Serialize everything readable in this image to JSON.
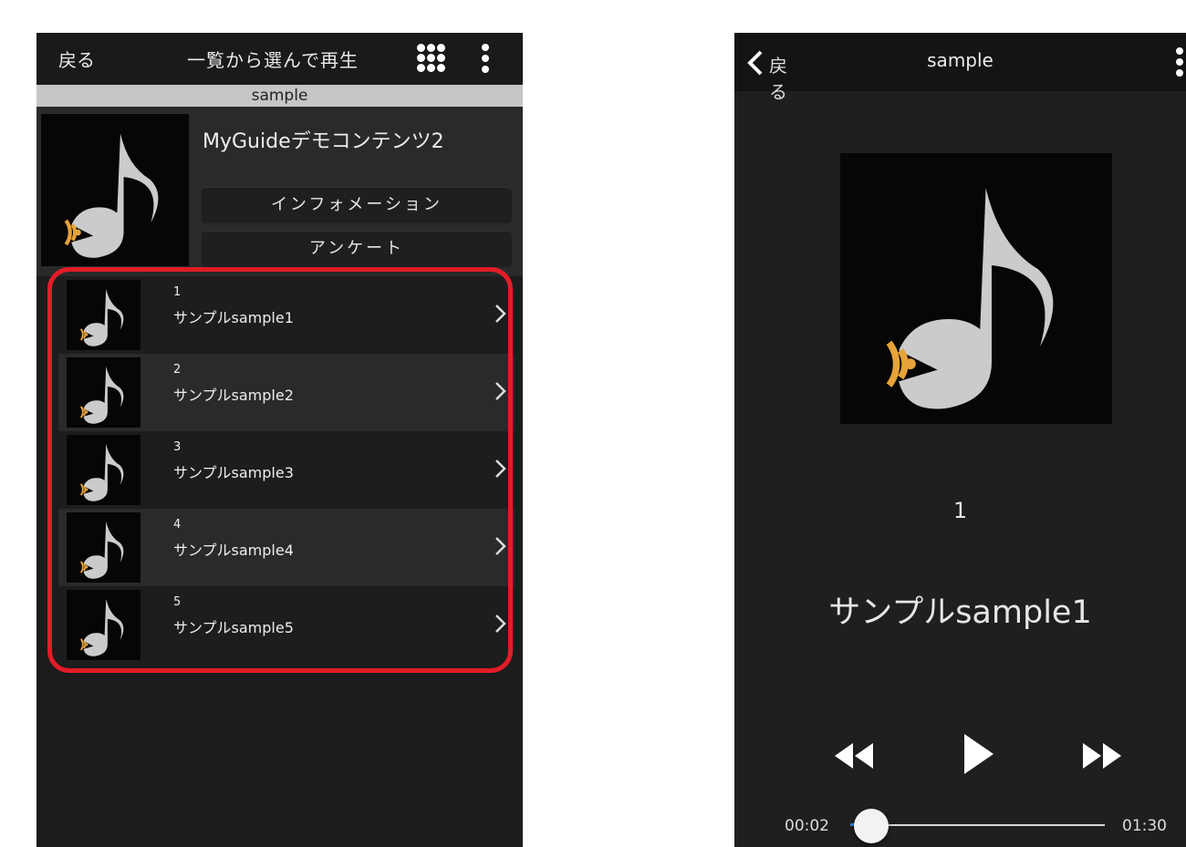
{
  "left_screen": {
    "header": {
      "back_label": "戻る",
      "title": "一覧から選んで再生"
    },
    "subheader": "sample",
    "info": {
      "title": "MyGuideデモコンテンツ2",
      "buttons": [
        "インフォメーション",
        "アンケート"
      ]
    },
    "list": [
      {
        "number": "1",
        "label": "サンプルsample1"
      },
      {
        "number": "2",
        "label": "サンプルsample2"
      },
      {
        "number": "3",
        "label": "サンプルsample3"
      },
      {
        "number": "4",
        "label": "サンプルsample4"
      },
      {
        "number": "5",
        "label": "サンプルsample5"
      }
    ]
  },
  "right_screen": {
    "header": {
      "back_label": "戻る",
      "title": "sample"
    },
    "track_number": "1",
    "track_title": "サンプルsample1",
    "player": {
      "elapsed": "00:02",
      "duration": "01:30",
      "progress": 0.022
    }
  },
  "colors": {
    "highlight": "#e21d26",
    "wave_accent": "#e6a33a",
    "seek_progress": "#2f7de1"
  },
  "icons": [
    "music-note-icon",
    "grid-menu-icon",
    "more-vertical-icon",
    "chevron-right-icon",
    "back-chevron-icon",
    "rewind-icon",
    "play-icon",
    "fast-forward-icon"
  ]
}
